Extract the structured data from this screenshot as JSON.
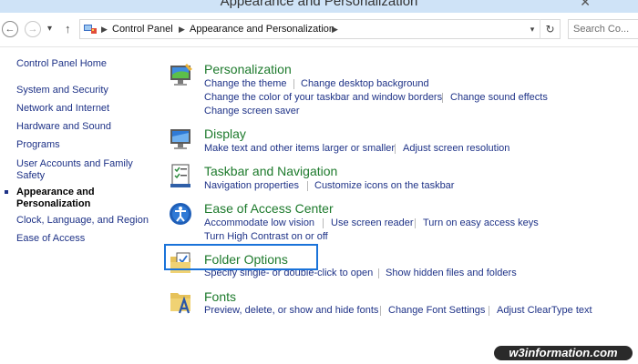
{
  "window": {
    "title": "Appearance and Personalization"
  },
  "address_bar": {
    "breadcrumbs": [
      "Control Panel",
      "Appearance and Personalization"
    ],
    "search_placeholder": "Search Co..."
  },
  "sidebar": {
    "items": [
      {
        "label": "Control Panel Home"
      },
      {
        "label": "System and Security"
      },
      {
        "label": "Network and Internet"
      },
      {
        "label": "Hardware and Sound"
      },
      {
        "label": "Programs"
      },
      {
        "label": "User Accounts and Family Safety"
      },
      {
        "label": "Appearance and Personalization",
        "active": true
      },
      {
        "label": "Clock, Language, and Region"
      },
      {
        "label": "Ease of Access"
      }
    ]
  },
  "categories": [
    {
      "title": "Personalization",
      "icon": "personalization-icon",
      "links": [
        "Change the theme",
        "Change desktop background",
        "Change the color of your taskbar and window borders",
        "Change sound effects",
        "Change screen saver"
      ]
    },
    {
      "title": "Display",
      "icon": "display-icon",
      "links": [
        "Make text and other items larger or smaller",
        "Adjust screen resolution"
      ]
    },
    {
      "title": "Taskbar and Navigation",
      "icon": "taskbar-icon",
      "links": [
        "Navigation properties",
        "Customize icons on the taskbar"
      ]
    },
    {
      "title": "Ease of Access Center",
      "icon": "ease-of-access-icon",
      "links": [
        "Accommodate low vision",
        "Use screen reader",
        "Turn on easy access keys",
        "Turn High Contrast on or off"
      ]
    },
    {
      "title": "Folder Options",
      "icon": "folder-options-icon",
      "highlighted": true,
      "links": [
        "Specify single- or double-click to open",
        "Show hidden files and folders"
      ]
    },
    {
      "title": "Fonts",
      "icon": "fonts-icon",
      "links": [
        "Preview, delete, or show and hide fonts",
        "Change Font Settings",
        "Adjust ClearType text"
      ]
    }
  ],
  "watermark": {
    "text": "w3information.com"
  },
  "colors": {
    "link": "#1e3287",
    "category_title": "#1d7a2c",
    "highlight_border": "#1a73d9",
    "titlebar": "#cfe3f7"
  }
}
